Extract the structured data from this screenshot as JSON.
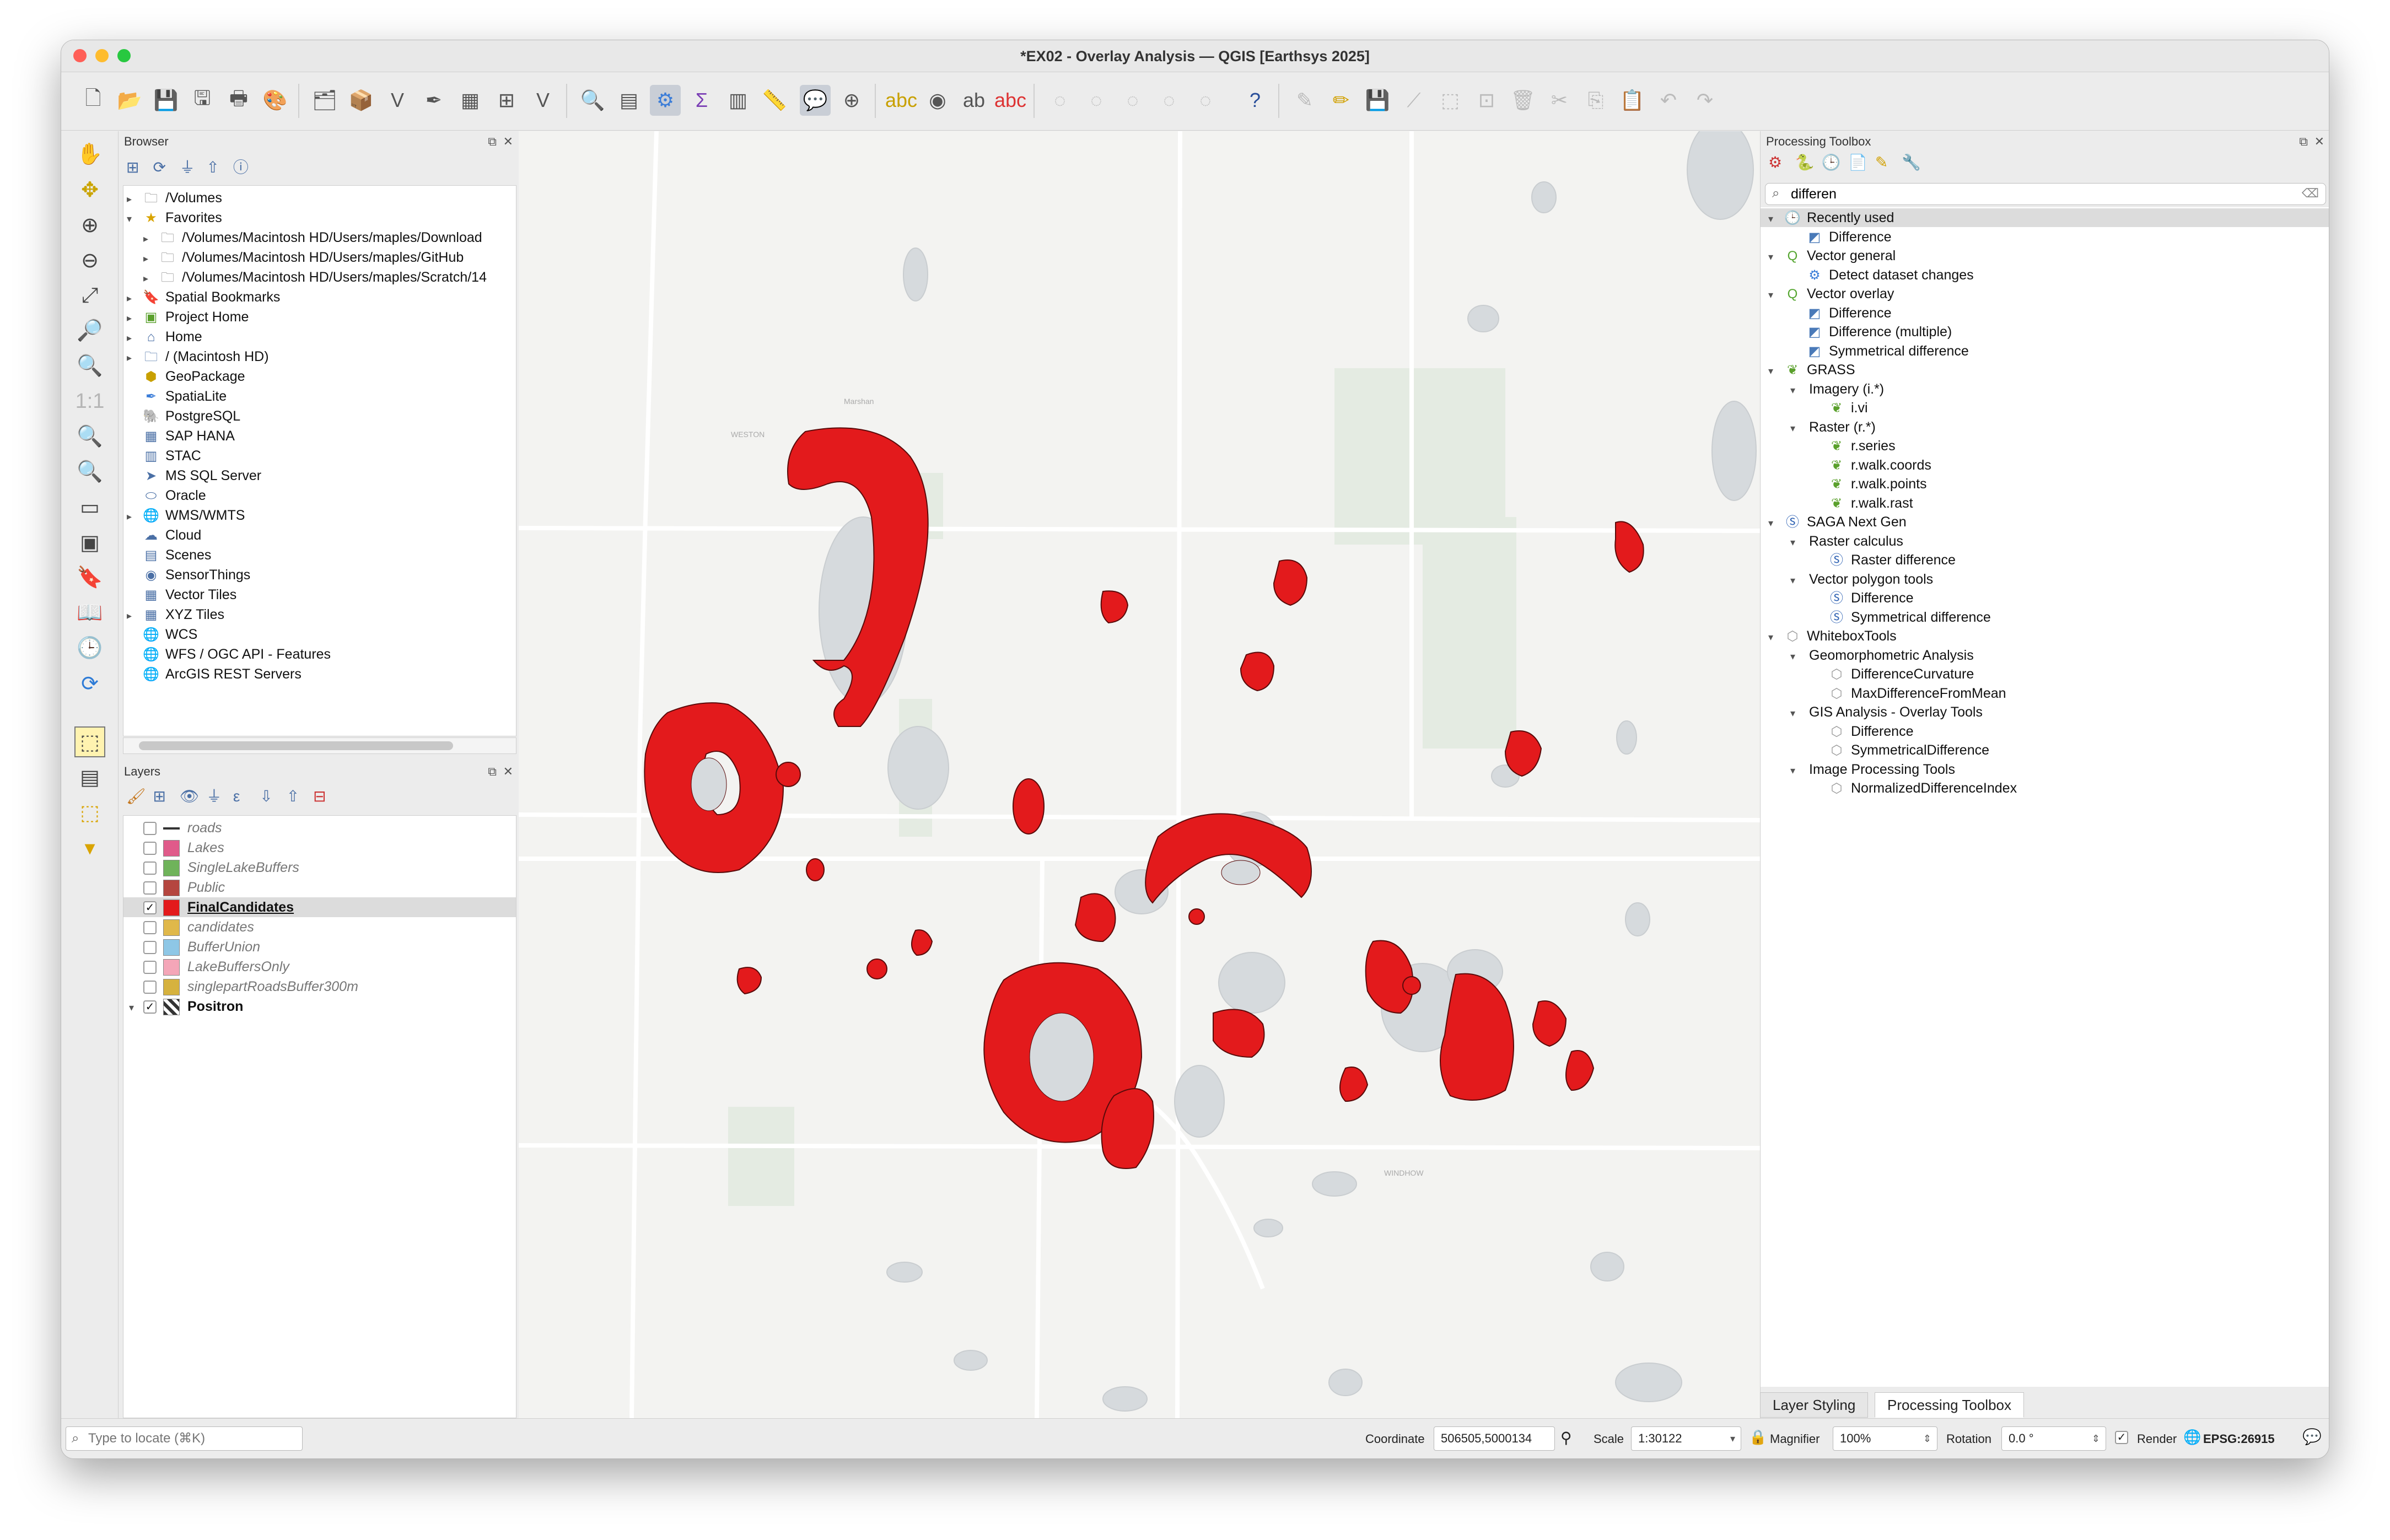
{
  "window": {
    "title": "*EX02 - Overlay Analysis — QGIS [Earthsys 2025]"
  },
  "colors": {
    "accent": "#e31a1c",
    "water": "#d6dadd",
    "park": "#e6ece3"
  },
  "toolbar": {
    "icons": [
      "new-project-icon",
      "open-project-icon",
      "save-project-icon",
      "save-as-icon",
      "print-layout-icon",
      "style-manager-icon",
      "data-source-manager-icon",
      "add-vector-icon",
      "add-raster-icon",
      "digitize-icon",
      "add-csv-icon",
      "add-mesh-icon",
      "add-virtual-layer-icon",
      "identify-icon",
      "attribute-table-icon",
      "processing-toolbox-icon",
      "sum-icon",
      "open-table-icon",
      "measure-icon",
      "map-tips-icon",
      "select-features-icon",
      "label-icon",
      "label-tool-icon",
      "label-pin-icon",
      "label-show-icon"
    ]
  },
  "browser": {
    "title": "Browser",
    "items": [
      {
        "label": "/Volumes",
        "icon": "folder-icon",
        "level": 0,
        "expander": "▸"
      },
      {
        "label": "Favorites",
        "icon": "star-icon",
        "level": 0,
        "expander": "▾"
      },
      {
        "label": "/Volumes/Macintosh HD/Users/maples/Download",
        "icon": "folder-icon",
        "level": 1,
        "expander": "▸"
      },
      {
        "label": "/Volumes/Macintosh HD/Users/maples/GitHub",
        "icon": "folder-icon",
        "level": 1,
        "expander": "▸"
      },
      {
        "label": "/Volumes/Macintosh HD/Users/maples/Scratch/14",
        "icon": "folder-icon",
        "level": 1,
        "expander": "▸"
      },
      {
        "label": "Spatial Bookmarks",
        "icon": "bookmark-icon",
        "level": 0,
        "expander": "▸"
      },
      {
        "label": "Project Home",
        "icon": "project-home-icon",
        "level": 0,
        "expander": "▸"
      },
      {
        "label": "Home",
        "icon": "home-icon",
        "level": 0,
        "expander": "▸"
      },
      {
        "label": "/ (Macintosh HD)",
        "icon": "drive-icon",
        "level": 0,
        "expander": "▸"
      },
      {
        "label": "GeoPackage",
        "icon": "geopackage-icon",
        "level": 0,
        "expander": ""
      },
      {
        "label": "SpatiaLite",
        "icon": "spatialite-icon",
        "level": 0,
        "expander": ""
      },
      {
        "label": "PostgreSQL",
        "icon": "postgresql-icon",
        "level": 0,
        "expander": ""
      },
      {
        "label": "SAP HANA",
        "icon": "sap-hana-icon",
        "level": 0,
        "expander": ""
      },
      {
        "label": "STAC",
        "icon": "stac-icon",
        "level": 0,
        "expander": ""
      },
      {
        "label": "MS SQL Server",
        "icon": "mssql-icon",
        "level": 0,
        "expander": ""
      },
      {
        "label": "Oracle",
        "icon": "oracle-icon",
        "level": 0,
        "expander": ""
      },
      {
        "label": "WMS/WMTS",
        "icon": "wms-icon",
        "level": 0,
        "expander": "▸"
      },
      {
        "label": "Cloud",
        "icon": "cloud-icon",
        "level": 0,
        "expander": ""
      },
      {
        "label": "Scenes",
        "icon": "scenes-icon",
        "level": 0,
        "expander": ""
      },
      {
        "label": "SensorThings",
        "icon": "sensorthings-icon",
        "level": 0,
        "expander": ""
      },
      {
        "label": "Vector Tiles",
        "icon": "vector-tiles-icon",
        "level": 0,
        "expander": ""
      },
      {
        "label": "XYZ Tiles",
        "icon": "xyz-tiles-icon",
        "level": 0,
        "expander": "▸"
      },
      {
        "label": "WCS",
        "icon": "wcs-icon",
        "level": 0,
        "expander": ""
      },
      {
        "label": "WFS / OGC API - Features",
        "icon": "wfs-icon",
        "level": 0,
        "expander": ""
      },
      {
        "label": "ArcGIS REST Servers",
        "icon": "arcgis-icon",
        "level": 0,
        "expander": ""
      }
    ]
  },
  "layers": {
    "title": "Layers",
    "items": [
      {
        "name": "roads",
        "checked": false,
        "color": "#333333",
        "style": "line",
        "bold": false,
        "italic": true
      },
      {
        "name": "Lakes",
        "checked": false,
        "color": "#e05a8a",
        "style": "fill",
        "bold": false,
        "italic": true
      },
      {
        "name": "SingleLakeBuffers",
        "checked": false,
        "color": "#6fb35a",
        "style": "fill",
        "bold": false,
        "italic": true
      },
      {
        "name": "Public",
        "checked": false,
        "color": "#b5463f",
        "style": "fill",
        "bold": false,
        "italic": true
      },
      {
        "name": "FinalCandidates",
        "checked": true,
        "color": "#e31a1c",
        "style": "fill",
        "bold": true,
        "italic": false
      },
      {
        "name": "candidates",
        "checked": false,
        "color": "#e0b84a",
        "style": "fill",
        "bold": false,
        "italic": true
      },
      {
        "name": "BufferUnion",
        "checked": false,
        "color": "#8ec7e6",
        "style": "fill",
        "bold": false,
        "italic": true
      },
      {
        "name": "LakeBuffersOnly",
        "checked": false,
        "color": "#f4a6b8",
        "style": "fill",
        "bold": false,
        "italic": true
      },
      {
        "name": "singlepartRoadsBuffer300m",
        "checked": false,
        "color": "#d6b23e",
        "style": "fill",
        "bold": false,
        "italic": true
      },
      {
        "name": "Positron",
        "checked": true,
        "color": "#333333",
        "style": "raster",
        "bold": true,
        "italic": false
      }
    ]
  },
  "processing": {
    "title": "Processing Toolbox",
    "search_value": "differen",
    "items": [
      {
        "label": "Recently used",
        "level": 0,
        "expander": "▾",
        "icon": "clock-icon",
        "selected": true
      },
      {
        "label": "Difference",
        "level": 1,
        "expander": "",
        "icon": "vector-algorithm-icon"
      },
      {
        "label": "Vector general",
        "level": 0,
        "expander": "▾",
        "icon": "qgis-provider-icon"
      },
      {
        "label": "Detect dataset changes",
        "level": 1,
        "expander": "",
        "icon": "gear-algorithm-icon"
      },
      {
        "label": "Vector overlay",
        "level": 0,
        "expander": "▾",
        "icon": "qgis-provider-icon"
      },
      {
        "label": "Difference",
        "level": 1,
        "expander": "",
        "icon": "vector-algorithm-icon"
      },
      {
        "label": "Difference (multiple)",
        "level": 1,
        "expander": "",
        "icon": "vector-algorithm-icon"
      },
      {
        "label": "Symmetrical difference",
        "level": 1,
        "expander": "",
        "icon": "vector-algorithm-icon"
      },
      {
        "label": "GRASS",
        "level": 0,
        "expander": "▾",
        "icon": "grass-icon"
      },
      {
        "label": "Imagery (i.*)",
        "level": 1,
        "expander": "▾",
        "icon": ""
      },
      {
        "label": "i.vi",
        "level": 2,
        "expander": "",
        "icon": "grass-icon"
      },
      {
        "label": "Raster (r.*)",
        "level": 1,
        "expander": "▾",
        "icon": ""
      },
      {
        "label": "r.series",
        "level": 2,
        "expander": "",
        "icon": "grass-icon"
      },
      {
        "label": "r.walk.coords",
        "level": 2,
        "expander": "",
        "icon": "grass-icon"
      },
      {
        "label": "r.walk.points",
        "level": 2,
        "expander": "",
        "icon": "grass-icon"
      },
      {
        "label": "r.walk.rast",
        "level": 2,
        "expander": "",
        "icon": "grass-icon"
      },
      {
        "label": "SAGA Next Gen",
        "level": 0,
        "expander": "▾",
        "icon": "saga-icon"
      },
      {
        "label": "Raster calculus",
        "level": 1,
        "expander": "▾",
        "icon": ""
      },
      {
        "label": "Raster difference",
        "level": 2,
        "expander": "",
        "icon": "saga-icon"
      },
      {
        "label": "Vector polygon tools",
        "level": 1,
        "expander": "▾",
        "icon": ""
      },
      {
        "label": "Difference",
        "level": 2,
        "expander": "",
        "icon": "saga-icon"
      },
      {
        "label": "Symmetrical difference",
        "level": 2,
        "expander": "",
        "icon": "saga-icon"
      },
      {
        "label": "WhiteboxTools",
        "level": 0,
        "expander": "▾",
        "icon": "whitebox-icon"
      },
      {
        "label": "Geomorphometric Analysis",
        "level": 1,
        "expander": "▾",
        "icon": ""
      },
      {
        "label": "DifferenceCurvature",
        "level": 2,
        "expander": "",
        "icon": "whitebox-icon"
      },
      {
        "label": "MaxDifferenceFromMean",
        "level": 2,
        "expander": "",
        "icon": "whitebox-icon"
      },
      {
        "label": "GIS Analysis - Overlay Tools",
        "level": 1,
        "expander": "▾",
        "icon": ""
      },
      {
        "label": "Difference",
        "level": 2,
        "expander": "",
        "icon": "whitebox-icon"
      },
      {
        "label": "SymmetricalDifference",
        "level": 2,
        "expander": "",
        "icon": "whitebox-icon"
      },
      {
        "label": "Image Processing Tools",
        "level": 1,
        "expander": "▾",
        "icon": ""
      },
      {
        "label": "NormalizedDifferenceIndex",
        "level": 2,
        "expander": "",
        "icon": "whitebox-icon"
      }
    ]
  },
  "tabs": {
    "layer_styling": "Layer Styling",
    "processing_toolbox": "Processing Toolbox"
  },
  "status": {
    "locate_placeholder": "Type to locate (⌘K)",
    "coordinate_label": "Coordinate",
    "coordinate_value": "506505,5000134",
    "scale_label": "Scale",
    "scale_value": "1:30122",
    "magnifier_label": "Magnifier",
    "magnifier_value": "100%",
    "rotation_label": "Rotation",
    "rotation_value": "0.0 °",
    "render_label": "Render",
    "render_checked": true,
    "crs": "EPSG:26915"
  }
}
